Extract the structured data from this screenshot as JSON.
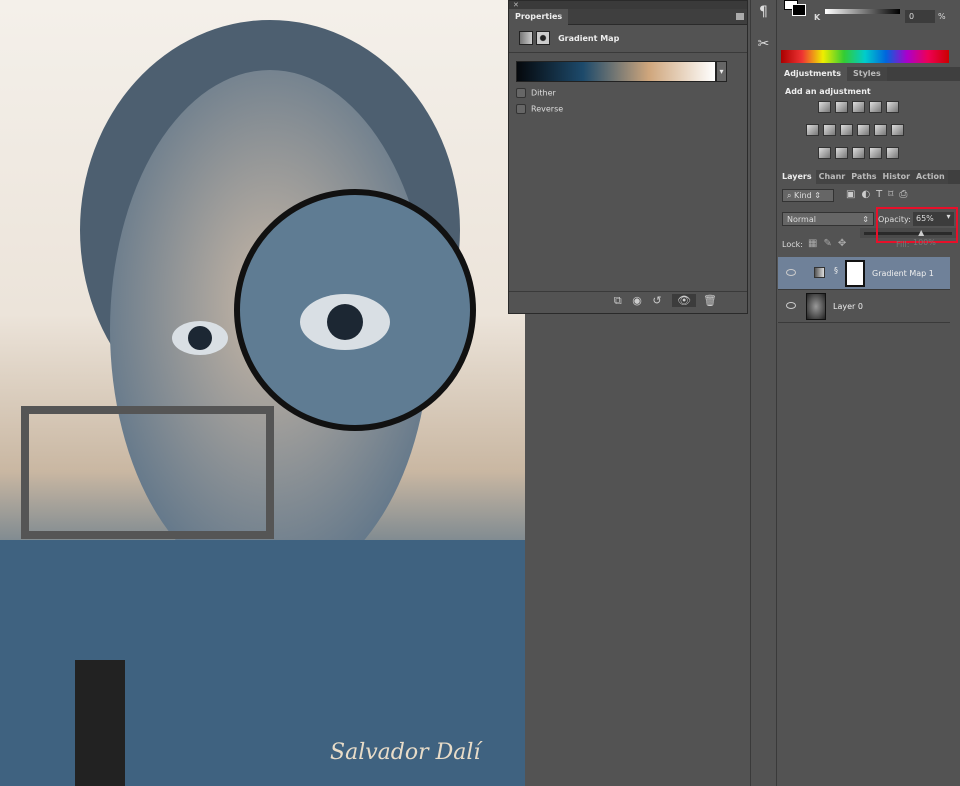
{
  "canvas": {
    "signature": "Salvador Dalí"
  },
  "properties": {
    "tab": "Properties",
    "adjustment_name": "Gradient Map",
    "gradient_colors": [
      "#05080c",
      "#1d4a6b",
      "#cfa67c",
      "#ffffff"
    ],
    "dither_label": "Dither",
    "dither_checked": false,
    "reverse_label": "Reverse",
    "reverse_checked": false
  },
  "color": {
    "channel_label": "K",
    "value": "0",
    "unit": "%"
  },
  "adjustments": {
    "tabs": [
      "Adjustments",
      "Styles"
    ],
    "heading": "Add an adjustment"
  },
  "layers": {
    "tabs": [
      "Layers",
      "Chanr",
      "Paths",
      "Histor",
      "Action"
    ],
    "filter_kind": "Kind",
    "blend_mode": "Normal",
    "opacity_label": "Opacity:",
    "opacity_value": "65%",
    "opacity_slider": 65,
    "lock_label": "Lock:",
    "fill_label": "Fill:",
    "fill_value": "100%",
    "highlight_color": "#e8102a",
    "items": [
      {
        "name": "Gradient Map 1",
        "selected": true
      },
      {
        "name": "Layer 0",
        "selected": false
      }
    ]
  }
}
